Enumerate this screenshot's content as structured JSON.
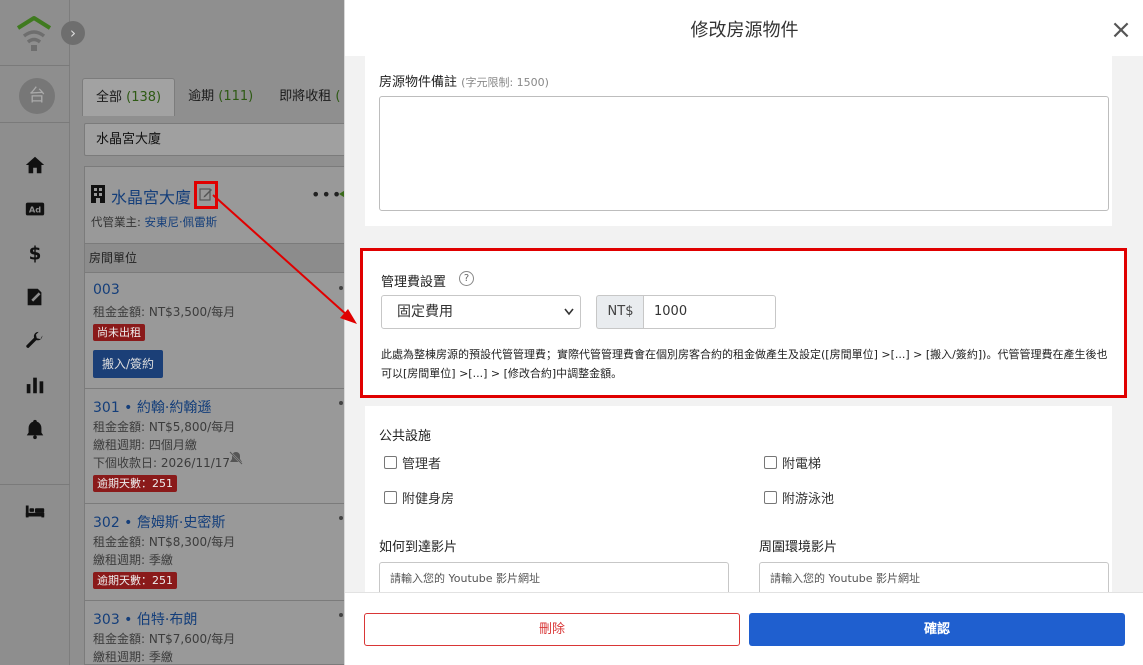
{
  "colors": {
    "primary": "#1f5fcf",
    "danger": "#d93636",
    "highlight": "#e00000",
    "link": "#143e7a"
  },
  "rail": {
    "avatar_text": "台",
    "expand_icon": "chevron-right-icon",
    "nav_icons": [
      "home-icon",
      "ad-icon",
      "dollar-icon",
      "contract-icon",
      "wrench-icon",
      "chart-icon",
      "bell-icon",
      "bed-icon"
    ]
  },
  "list": {
    "tabs": [
      {
        "label": "全部",
        "count": "(138)"
      },
      {
        "label": "逾期",
        "count": "(111)"
      },
      {
        "label": "即將收租",
        "count": "("
      }
    ],
    "search_value": "水晶宮大廈",
    "property": {
      "name": "水晶宮大廈",
      "agent_label": "代管業主:",
      "agent_name": "安東尼·佩雷斯",
      "more": "•••",
      "units_header": "房間單位"
    },
    "units": [
      {
        "name": "003",
        "rent": "租金金額: NT$3,500/每月",
        "badge": "尚未出租",
        "action": "搬入/簽約"
      },
      {
        "name": "301 • 約翰·約翰遜",
        "rent": "租金金額: NT$5,800/每月",
        "cycle": "繳租週期: 四個月繳",
        "next": "下個收款日: 2026/11/17",
        "badge": "逾期天數：251"
      },
      {
        "name": "302 • 詹姆斯·史密斯",
        "rent": "租金金額: NT$8,300/每月",
        "cycle": "繳租週期: 季繳",
        "badge": "逾期天數：251"
      },
      {
        "name": "303 • 伯特·布朗",
        "rent": "租金金額: NT$7,600/每月",
        "cycle": "繳租週期: 季繳"
      }
    ]
  },
  "modal": {
    "title": "修改房源物件",
    "close": "×",
    "notes": {
      "label": "房源物件備註",
      "hint": "(字元限制: 1500)",
      "value": ""
    },
    "mgmt": {
      "label": "管理費設置",
      "help": "?",
      "mode": "固定費用",
      "currency": "NT$",
      "amount": "1000",
      "description": "此處為整棟房源的預設代管管理費；實際代管管理費會在個別房客合約的租金做產生及設定([房間單位] >[...] > [搬入/簽約])。代管管理費在產生後也可以[房間單位] >[...] > [修改合約]中調整金額。"
    },
    "facilities": {
      "label": "公共設施",
      "items": [
        "管理者",
        "附電梯",
        "附健身房",
        "附游泳池"
      ]
    },
    "video_route": {
      "label": "如何到達影片",
      "placeholder": "請輸入您的 Youtube 影片網址"
    },
    "video_env": {
      "label": "周圍環境影片",
      "placeholder": "請輸入您的 Youtube 影片網址"
    },
    "delete_label": "刪除",
    "confirm_label": "確認"
  }
}
